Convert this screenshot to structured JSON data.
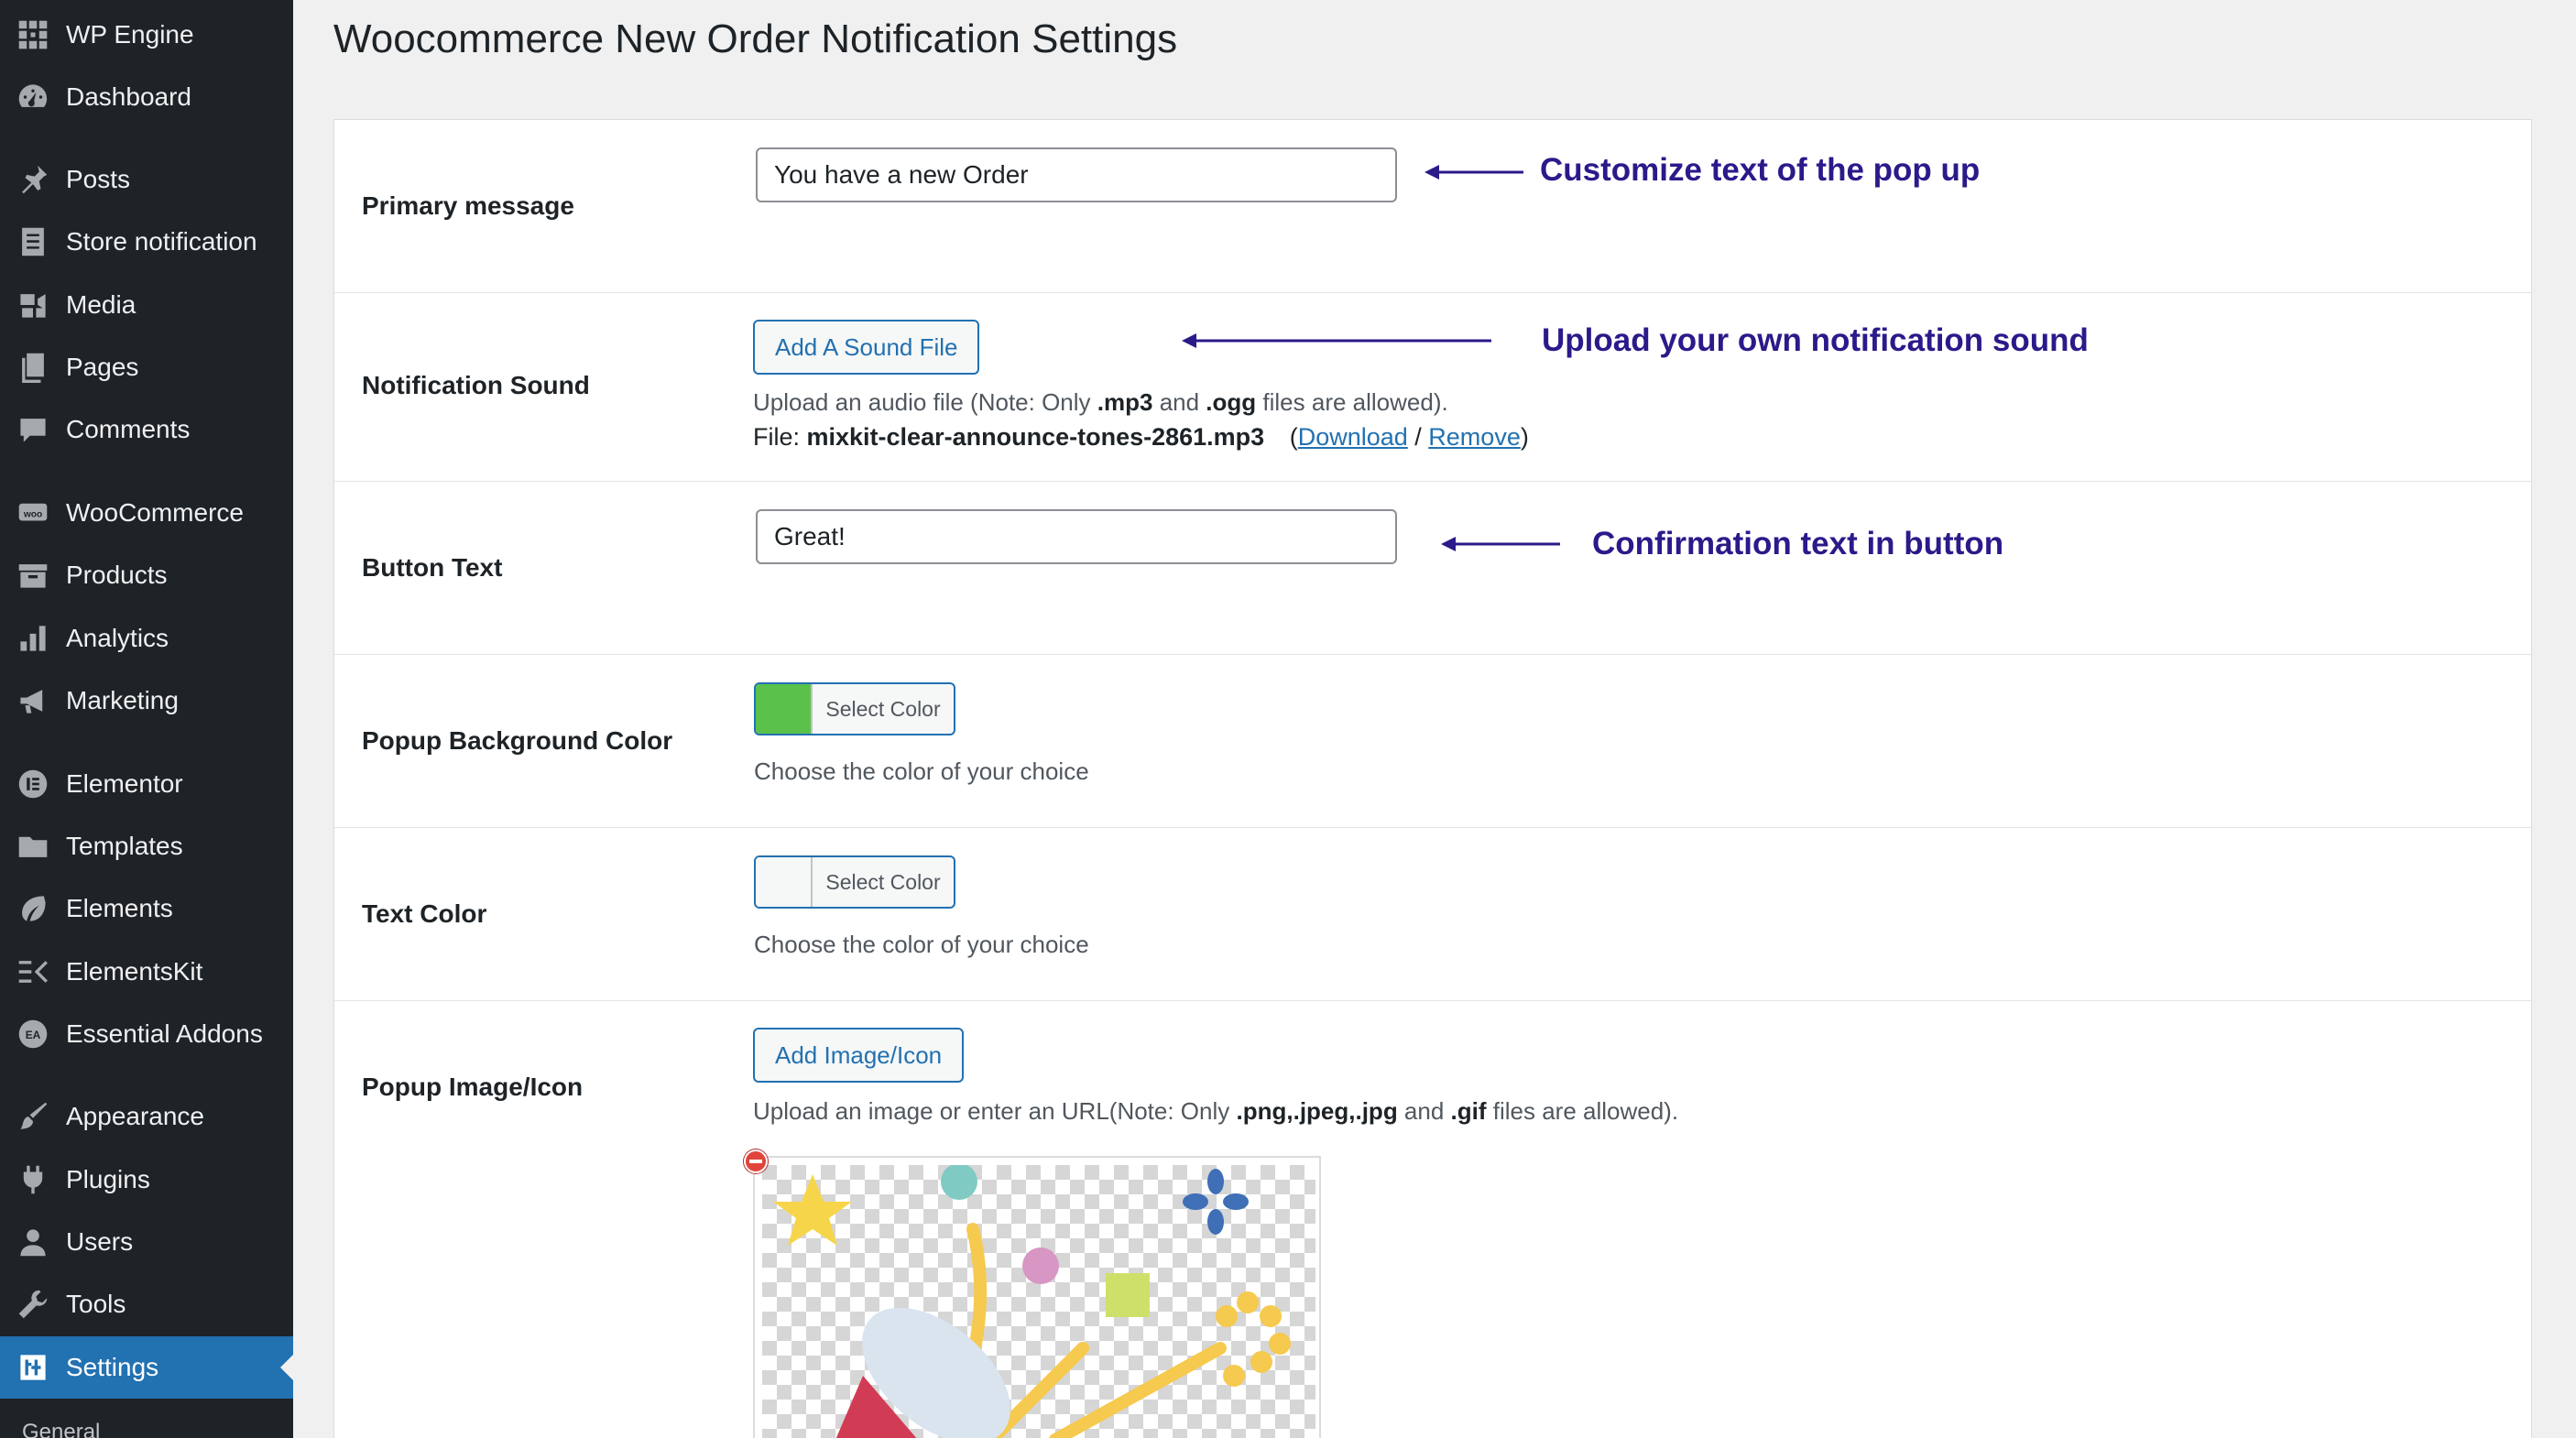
{
  "sidebar": {
    "items": [
      {
        "label": "WP Engine",
        "icon": "wp-engine-icon"
      },
      {
        "label": "Dashboard",
        "icon": "dashboard-icon"
      },
      {
        "label": "Posts",
        "icon": "pushpin-icon"
      },
      {
        "label": "Store notification",
        "icon": "document-icon"
      },
      {
        "label": "Media",
        "icon": "media-icon"
      },
      {
        "label": "Pages",
        "icon": "pages-icon"
      },
      {
        "label": "Comments",
        "icon": "comment-icon"
      },
      {
        "label": "WooCommerce",
        "icon": "woo-icon"
      },
      {
        "label": "Products",
        "icon": "archive-icon"
      },
      {
        "label": "Analytics",
        "icon": "bar-chart-icon"
      },
      {
        "label": "Marketing",
        "icon": "megaphone-icon"
      },
      {
        "label": "Elementor",
        "icon": "elementor-icon"
      },
      {
        "label": "Templates",
        "icon": "folder-icon"
      },
      {
        "label": "Elements",
        "icon": "leaf-icon"
      },
      {
        "label": "ElementsKit",
        "icon": "elementskit-icon"
      },
      {
        "label": "Essential Addons",
        "icon": "essential-addons-icon"
      },
      {
        "label": "Appearance",
        "icon": "paintbrush-icon"
      },
      {
        "label": "Plugins",
        "icon": "plug-icon"
      },
      {
        "label": "Users",
        "icon": "user-icon"
      },
      {
        "label": "Tools",
        "icon": "wrench-icon"
      },
      {
        "label": "Settings",
        "icon": "settings-icon"
      }
    ],
    "submenu_peek": "General"
  },
  "page": {
    "title": "Woocommerce New Order Notification Settings"
  },
  "form": {
    "primary_message": {
      "label": "Primary message",
      "value": "You have a new Order",
      "annotation": "Customize text of the pop up"
    },
    "notification_sound": {
      "label": "Notification Sound",
      "button": "Add A Sound File",
      "desc_prefix": "Upload an audio file (Note: Only ",
      "ext1": ".mp3",
      "desc_mid": " and ",
      "ext2": ".ogg",
      "desc_suffix": " files are allowed).",
      "file_prefix": "File: ",
      "file_name": "mixkit-clear-announce-tones-2861.mp3",
      "open_paren": "(",
      "download": "Download",
      "slash": " / ",
      "remove": "Remove",
      "close_paren": ")",
      "annotation": "Upload your own notification sound"
    },
    "button_text": {
      "label": "Button Text",
      "value": "Great!",
      "annotation": "Confirmation text in button"
    },
    "popup_bg_color": {
      "label": "Popup Background Color",
      "button": "Select Color",
      "swatch": "#5ac24a",
      "desc": "Choose the color of your choice"
    },
    "text_color": {
      "label": "Text Color",
      "button": "Select Color",
      "swatch": "#f6f7f7",
      "desc": "Choose the color of your choice"
    },
    "popup_image": {
      "label": "Popup Image/Icon",
      "button": "Add Image/Icon",
      "desc_prefix": "Upload an image or enter an URL(Note: Only ",
      "exts": ".png,.jpeg,.jpg",
      "desc_mid": " and ",
      "ext_gif": ".gif",
      "desc_suffix": " files are allowed)."
    }
  },
  "colors": {
    "sidebar_bg": "#1d2327",
    "active_bg": "#2271b1",
    "annotation": "#2a1a8a"
  }
}
